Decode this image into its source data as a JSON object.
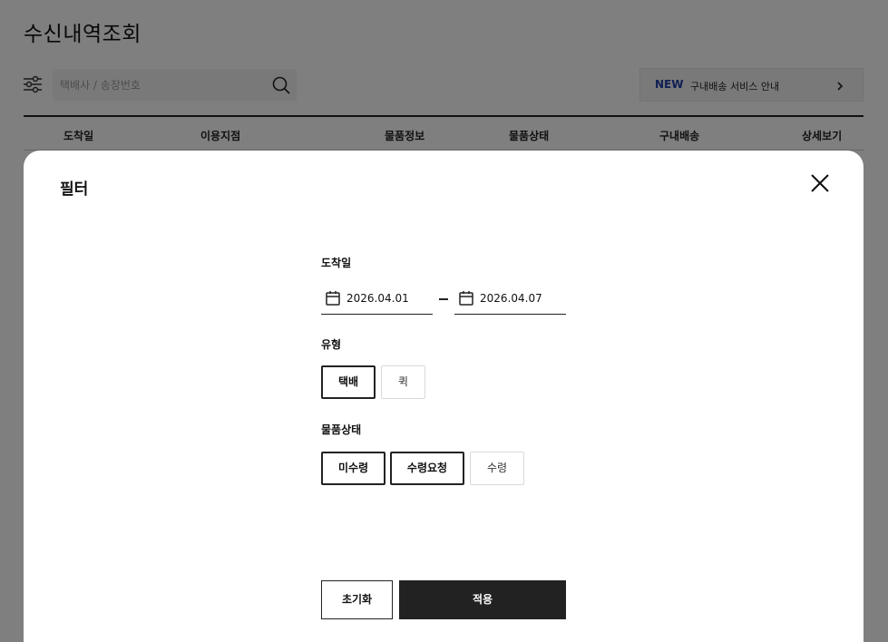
{
  "page": {
    "title": "수신내역조회",
    "search": {
      "placeholder": "택배사 / 송장번호",
      "value": ""
    },
    "notice": {
      "badge": "NEW",
      "text": "구내배송 서비스 안내"
    },
    "table": {
      "columns": [
        "도착일",
        "이용지점",
        "물품정보",
        "물품상태",
        "구내배송",
        "상세보기"
      ]
    }
  },
  "modal": {
    "title": "필터",
    "arrival_date": {
      "label": "도착일",
      "start": "2026.04.01",
      "end": "2026.04.07"
    },
    "type": {
      "label": "유형",
      "options": [
        {
          "label": "택배",
          "selected": true
        },
        {
          "label": "퀵",
          "selected": false
        }
      ]
    },
    "item_status": {
      "label": "물품상태",
      "options": [
        {
          "label": "미수령",
          "selected": true
        },
        {
          "label": "수령요청",
          "selected": true
        },
        {
          "label": "수령",
          "selected": false
        }
      ]
    },
    "reset_label": "초기화",
    "apply_label": "적용"
  },
  "colors": {
    "accent": "#1e3ea8",
    "primary_button": "#222222",
    "overlay": "rgba(0,0,0,0.5)"
  },
  "icons": [
    "filter-icon",
    "search-icon",
    "chevron-right-icon",
    "close-icon",
    "calendar-icon"
  ]
}
